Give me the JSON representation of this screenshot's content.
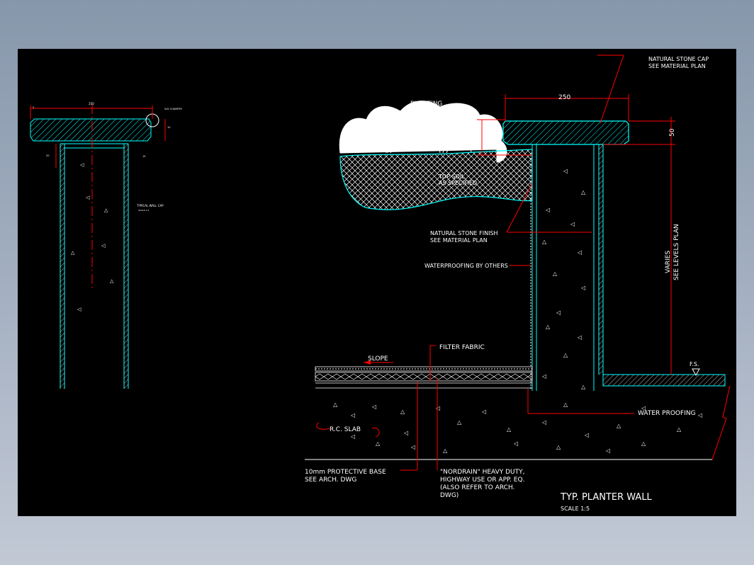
{
  "drawing": {
    "title": "TYP. PLANTER WALL",
    "scale": "SCALE 1:5",
    "labels": {
      "stone_cap_1": "NATURAL STONE CAP",
      "stone_cap_2": "SEE MATERIAL PLAN",
      "planting": "PLANTING",
      "topsoil_1": "TOP SOIL",
      "topsoil_2": "AS SPECIFIED",
      "stone_finish_1": "NATURAL STONE FINISH",
      "stone_finish_2": "SEE MATERIAL PLAN",
      "waterproofing_others": "WATERPROOFING BY OTHERS",
      "filter_fabric": "FILTER FABRIC",
      "slope": "SLOPE",
      "rc_slab": "R.C. SLAB",
      "water_proofing": "WATER PROOFING",
      "fs": "F.S.",
      "protective_1": "10mm PROTECTIVE BASE",
      "protective_2": "SEE ARCH. DWG",
      "nordrain_1": "\"NORDRAIN\" HEAVY DUTY,",
      "nordrain_2": "HIGHWAY USE OR APP. EQ.",
      "nordrain_3": "(ALSO REFER TO ARCH.",
      "nordrain_4": "DWG)",
      "varies_1": "VARIES",
      "varies_2": "SEE LEVELS PLAN",
      "dim_250": "250",
      "dim_50": "50",
      "dim_20": "20"
    },
    "small_detail": {
      "dim_top": "250",
      "chamfer": "5x5 CHAMFER",
      "caption": "TYPICAL WALL CAP",
      "caption_scale": "SCALE 1:2",
      "dim_a": "5",
      "dim_b": "10",
      "dim_c": "20",
      "dim_d": "15"
    }
  },
  "colors": {
    "line": "#00ffff",
    "dimension": "#ff0000",
    "text": "#ffffff",
    "background": "#000000"
  }
}
